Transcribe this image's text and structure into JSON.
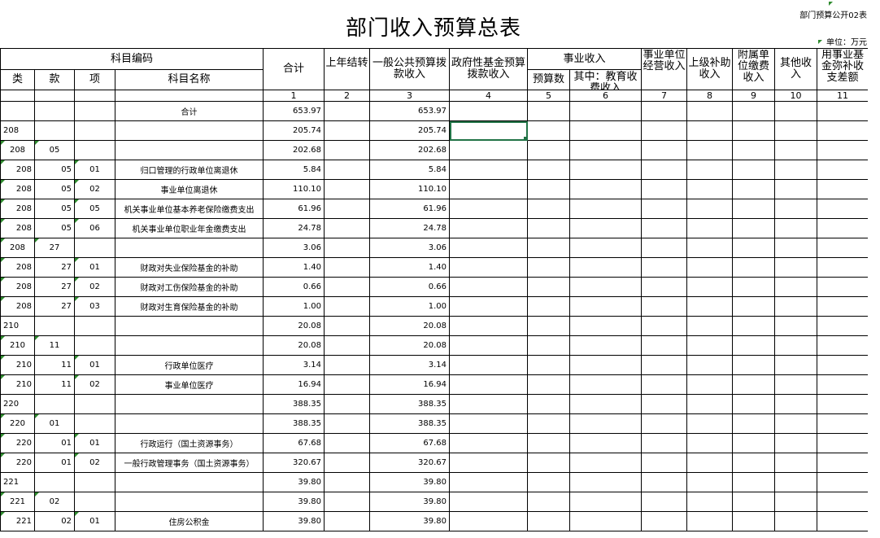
{
  "title": "部门收入预算总表",
  "form_no": "部门预算公开02表",
  "unit": "单位：万元",
  "headers": {
    "code": "科目编码",
    "lei": "类",
    "kuan": "款",
    "xiang": "项",
    "name": "科目名称",
    "total": "合计",
    "carryover": "上年结转",
    "general_budget": "一般公共预算拨款收入",
    "gov_fund": "政府性基金预算拨款收入",
    "business_income": "事业收入",
    "budget_count": "预算数",
    "edu_fee": "其中：教育收费收入",
    "operating_income": "事业单位经营收入",
    "superior_subsidy": "上级补助收入",
    "affiliated_payment": "附属单位缴费收入",
    "other_income": "其他收入",
    "fund_offset": "用事业基金弥补收支差额"
  },
  "col_numbers": [
    "1",
    "2",
    "3",
    "4",
    "5",
    "6",
    "7",
    "8",
    "9",
    "10",
    "11"
  ],
  "rows": [
    {
      "lei": "",
      "kuan": "",
      "xiang": "",
      "name": "合计",
      "total": "653.97",
      "general": "653.97"
    },
    {
      "lei": "208",
      "kuan": "",
      "xiang": "",
      "name": "",
      "total": "205.74",
      "general": "205.74"
    },
    {
      "lei": "208",
      "kuan": "05",
      "xiang": "",
      "name": "",
      "total": "202.68",
      "general": "202.68"
    },
    {
      "lei": "208",
      "kuan": "05",
      "xiang": "01",
      "name": "归口管理的行政单位离退休",
      "total": "5.84",
      "general": "5.84"
    },
    {
      "lei": "208",
      "kuan": "05",
      "xiang": "02",
      "name": "事业单位离退休",
      "total": "110.10",
      "general": "110.10"
    },
    {
      "lei": "208",
      "kuan": "05",
      "xiang": "05",
      "name": "机关事业单位基本养老保险缴费支出",
      "total": "61.96",
      "general": "61.96"
    },
    {
      "lei": "208",
      "kuan": "05",
      "xiang": "06",
      "name": "机关事业单位职业年金缴费支出",
      "total": "24.78",
      "general": "24.78"
    },
    {
      "lei": "208",
      "kuan": "27",
      "xiang": "",
      "name": "",
      "total": "3.06",
      "general": "3.06"
    },
    {
      "lei": "208",
      "kuan": "27",
      "xiang": "01",
      "name": "财政对失业保险基金的补助",
      "total": "1.40",
      "general": "1.40"
    },
    {
      "lei": "208",
      "kuan": "27",
      "xiang": "02",
      "name": "财政对工伤保险基金的补助",
      "total": "0.66",
      "general": "0.66"
    },
    {
      "lei": "208",
      "kuan": "27",
      "xiang": "03",
      "name": "财政对生育保险基金的补助",
      "total": "1.00",
      "general": "1.00"
    },
    {
      "lei": "210",
      "kuan": "",
      "xiang": "",
      "name": "",
      "total": "20.08",
      "general": "20.08"
    },
    {
      "lei": "210",
      "kuan": "11",
      "xiang": "",
      "name": "",
      "total": "20.08",
      "general": "20.08"
    },
    {
      "lei": "210",
      "kuan": "11",
      "xiang": "01",
      "name": "行政单位医疗",
      "total": "3.14",
      "general": "3.14"
    },
    {
      "lei": "210",
      "kuan": "11",
      "xiang": "02",
      "name": "事业单位医疗",
      "total": "16.94",
      "general": "16.94"
    },
    {
      "lei": "220",
      "kuan": "",
      "xiang": "",
      "name": "",
      "total": "388.35",
      "general": "388.35"
    },
    {
      "lei": "220",
      "kuan": "01",
      "xiang": "",
      "name": "",
      "total": "388.35",
      "general": "388.35"
    },
    {
      "lei": "220",
      "kuan": "01",
      "xiang": "01",
      "name": "行政运行（国土资源事务）",
      "total": "67.68",
      "general": "67.68"
    },
    {
      "lei": "220",
      "kuan": "01",
      "xiang": "02",
      "name": "一般行政管理事务（国土资源事务）",
      "total": "320.67",
      "general": "320.67"
    },
    {
      "lei": "221",
      "kuan": "",
      "xiang": "",
      "name": "",
      "total": "39.80",
      "general": "39.80"
    },
    {
      "lei": "221",
      "kuan": "02",
      "xiang": "",
      "name": "",
      "total": "39.80",
      "general": "39.80"
    },
    {
      "lei": "221",
      "kuan": "02",
      "xiang": "01",
      "name": "住房公积金",
      "total": "39.80",
      "general": "39.80"
    }
  ],
  "colors": {
    "selection": "#217346",
    "comment_marker": "#2e8b2e"
  }
}
